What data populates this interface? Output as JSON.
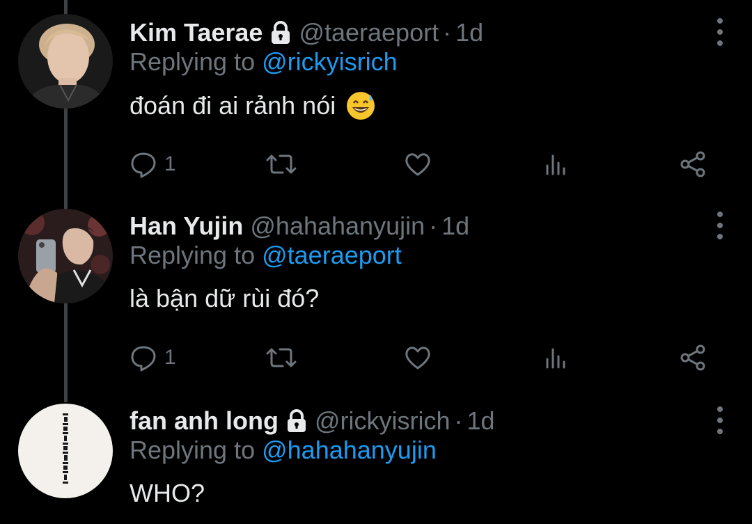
{
  "theme": {
    "background": "#000000",
    "text": "#e7e9ea",
    "muted": "#6e767d",
    "link": "#1d9bf0",
    "thread_line": "#3e4144"
  },
  "tweets": [
    {
      "name": "Kim Taerae",
      "protected": true,
      "handle": "@taeraeport",
      "separator": "·",
      "time": "1d",
      "replying_prefix": "Replying to ",
      "replying_to": "@rickyisrich",
      "text": "đoán đi ai rảnh nói",
      "emoji": "grinning-sweat-emoji",
      "reply_count": "1",
      "avatar": "profile-photo"
    },
    {
      "name": "Han Yujin",
      "protected": false,
      "handle": "@hahahanyujin",
      "separator": "·",
      "time": "1d",
      "replying_prefix": "Replying to ",
      "replying_to": "@taeraeport",
      "text": "là bận dữ rùi đó?",
      "reply_count": "1",
      "avatar": "profile-photo"
    },
    {
      "name": "fan anh long",
      "protected": true,
      "handle": "@rickyisrich",
      "separator": "·",
      "time": "1d",
      "replying_prefix": "Replying to ",
      "replying_to": "@hahahanyujin",
      "text": "WHO?",
      "avatar": "profile-logo"
    }
  ],
  "icons": {
    "reply": "speech-bubble-icon",
    "retweet": "retweet-icon",
    "like": "heart-icon",
    "views": "bar-chart-icon",
    "share": "share-icon",
    "more": "more-vertical-icon",
    "lock": "lock-icon"
  }
}
